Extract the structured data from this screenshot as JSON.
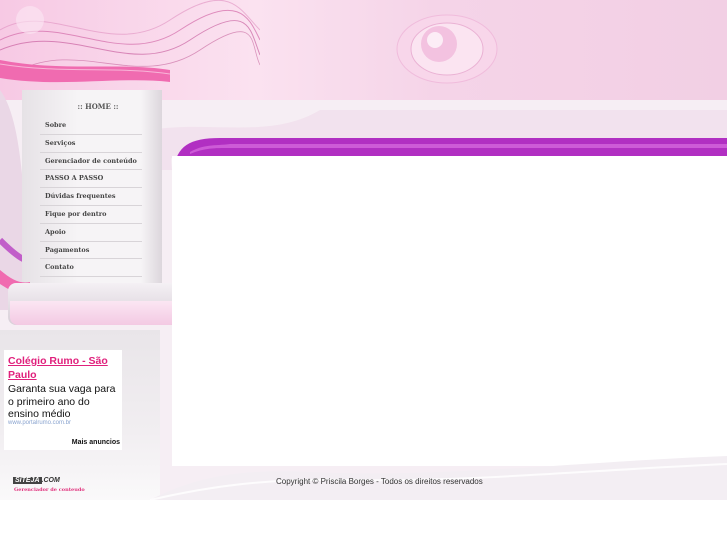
{
  "menu": {
    "home_label": ":: HOME ::",
    "items": [
      {
        "label": "Sobre"
      },
      {
        "label": "Serviços"
      },
      {
        "label": "Gerenciador de conteúdo"
      },
      {
        "label": "PASSO A PASSO"
      },
      {
        "label": "Dúvidas frequentes"
      },
      {
        "label": "Fique por dentro"
      },
      {
        "label": "Apoio"
      },
      {
        "label": "Pagamentos"
      },
      {
        "label": "Contato"
      }
    ]
  },
  "ad": {
    "title_line1": "Colégio Rumo - São",
    "title_line2": "Paulo",
    "description": "Garanta sua vaga para o primeiro ano do ensino médio",
    "url": "www.portalrumo.com.br",
    "more_label": "Mais anuncios"
  },
  "brand": {
    "logo_box": "SITEJA",
    "logo_suffix": ".COM",
    "subtitle": "Gerenciador de conteudo"
  },
  "footer": {
    "copyright": "Copyright © Priscila Borges - Todos os direitos reservados"
  },
  "colors": {
    "accent_pink": "#e0207c",
    "purple": "#b12fc2",
    "header_pink": "#f7c9e4"
  }
}
